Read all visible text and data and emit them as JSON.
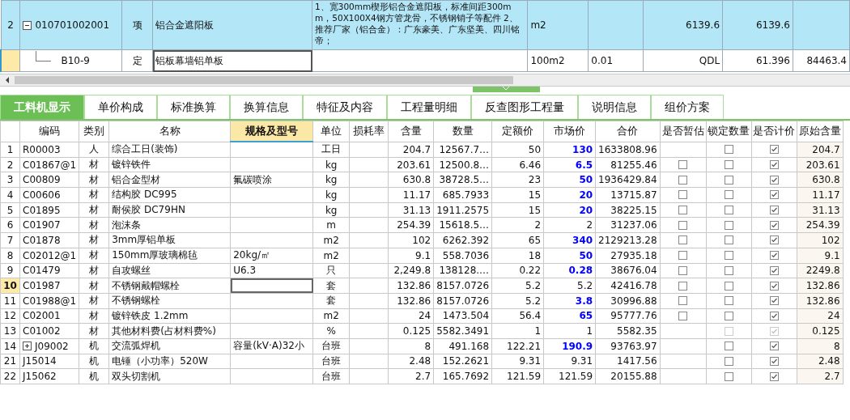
{
  "upper_grid": {
    "rows": [
      {
        "number": "2",
        "selected": false,
        "code": "010701002001",
        "expanded": true,
        "editing": false,
        "cells": [
          "项",
          "铝合金遮阳板",
          "1、宽300mm楔形铝合金遮阳板，标准间距300mm，50X100X4钢方管龙骨，不锈钢销子等配件 2、推荐厂家（铝合金）：广东豪美、广东坚美、四川铭帝；",
          "m2",
          null,
          "6139.6",
          "6139.6",
          null
        ]
      },
      {
        "selected": true,
        "code": "B10-9",
        "editing": true,
        "cells": [
          "定",
          "铝板幕墙铝单板",
          null,
          "100m2",
          "0.01",
          "QDL",
          "61.396",
          "84463.4"
        ]
      }
    ]
  },
  "tabs": [
    {
      "label": "工料机显示",
      "selected": true
    },
    {
      "label": "单价构成",
      "selected": false
    },
    {
      "label": "标准换算",
      "selected": false
    },
    {
      "label": "换算信息",
      "selected": false
    },
    {
      "label": "特征及内容",
      "selected": false
    },
    {
      "label": "工程量明细",
      "selected": false
    },
    {
      "label": "反查图形工程量",
      "selected": false
    },
    {
      "label": "说明信息",
      "selected": false
    },
    {
      "label": "组价方案",
      "selected": false
    }
  ],
  "table": {
    "columns": [
      {
        "label": "编码",
        "selected": false
      },
      {
        "label": "类别",
        "selected": false
      },
      {
        "label": "名称",
        "selected": false
      },
      {
        "label": "规格及型号",
        "selected": true
      },
      {
        "label": "单位",
        "selected": false
      },
      {
        "label": "损耗率",
        "selected": false
      },
      {
        "label": "含量",
        "selected": false
      },
      {
        "label": "数量",
        "selected": false
      },
      {
        "label": "定额价",
        "selected": false
      },
      {
        "label": "市场价",
        "selected": false
      },
      {
        "label": "合价",
        "selected": false
      },
      {
        "label": "是否暂估",
        "selected": false
      },
      {
        "label": "锁定数量",
        "selected": false
      },
      {
        "label": "是否计价",
        "selected": false
      },
      {
        "label": "原始含量",
        "selected": false
      }
    ],
    "rows": [
      {
        "number": "1",
        "selected": false,
        "code": "R00003",
        "type": "人",
        "name": "综合工日(装饰)",
        "unit": "工日",
        "amount": "204.7",
        "quantity": "12567.7…",
        "quota_price": "50",
        "market_price": "130",
        "modified": true,
        "total": "1633808.96",
        "locked": false,
        "priced": true,
        "disabled": false,
        "original": "204.7"
      },
      {
        "number": "2",
        "selected": false,
        "code": "C01867@1",
        "type": "材",
        "name": "镀锌铁件",
        "unit": "kg",
        "amount": "203.61",
        "quantity": "12500.8…",
        "quota_price": "6.46",
        "market_price": "6.5",
        "modified": true,
        "total": "81255.46",
        "provisional": false,
        "locked": false,
        "priced": true,
        "disabled": false,
        "original": "203.61"
      },
      {
        "number": "3",
        "selected": false,
        "code": "C00809",
        "type": "材",
        "name": "铝合金型材",
        "spec": "氟碳喷涂",
        "unit": "kg",
        "amount": "630.8",
        "quantity": "38728.5…",
        "quota_price": "23",
        "market_price": "50",
        "modified": true,
        "total": "1936429.84",
        "provisional": false,
        "locked": false,
        "priced": true,
        "disabled": false,
        "original": "630.8"
      },
      {
        "number": "4",
        "selected": false,
        "code": "C00606",
        "type": "材",
        "name": "结构胶 DC995",
        "unit": "kg",
        "amount": "11.17",
        "quantity": "685.7933",
        "quota_price": "15",
        "market_price": "20",
        "modified": true,
        "total": "13715.87",
        "provisional": false,
        "locked": false,
        "priced": true,
        "disabled": false,
        "original": "11.17"
      },
      {
        "number": "5",
        "selected": false,
        "code": "C01895",
        "type": "材",
        "name": "耐侯胶 DC79HN",
        "unit": "kg",
        "amount": "31.13",
        "quantity": "1911.2575",
        "quota_price": "15",
        "market_price": "20",
        "modified": true,
        "total": "38225.15",
        "provisional": false,
        "locked": false,
        "priced": true,
        "disabled": false,
        "original": "31.13"
      },
      {
        "number": "6",
        "selected": false,
        "code": "C01907",
        "type": "材",
        "name": "泡沫条",
        "unit": "m",
        "amount": "254.39",
        "quantity": "15618.5…",
        "quota_price": "2",
        "market_price": "2",
        "modified": false,
        "total": "31237.06",
        "provisional": false,
        "locked": false,
        "priced": true,
        "disabled": false,
        "original": "254.39"
      },
      {
        "number": "7",
        "selected": false,
        "code": "C01878",
        "type": "材",
        "name": "3mm厚铝单板",
        "unit": "m2",
        "amount": "102",
        "quantity": "6262.392",
        "quota_price": "65",
        "market_price": "340",
        "modified": true,
        "total": "2129213.28",
        "provisional": false,
        "locked": false,
        "priced": true,
        "disabled": false,
        "original": "102"
      },
      {
        "number": "8",
        "selected": false,
        "code": "C02012@1",
        "type": "材",
        "name": "150mm厚玻璃棉毡",
        "spec": "20kg/㎡",
        "unit": "m2",
        "amount": "9.1",
        "quantity": "558.7036",
        "quota_price": "18",
        "market_price": "50",
        "modified": true,
        "total": "27935.18",
        "provisional": false,
        "locked": false,
        "priced": true,
        "disabled": false,
        "original": "9.1"
      },
      {
        "number": "9",
        "selected": false,
        "code": "C01479",
        "type": "材",
        "name": "自攻螺丝",
        "spec": "U6.3",
        "unit": "只",
        "amount": "2,249.8",
        "quantity": "138128.…",
        "quota_price": "0.22",
        "market_price": "0.28",
        "modified": true,
        "total": "38676.04",
        "provisional": false,
        "locked": false,
        "priced": true,
        "disabled": false,
        "original": "2249.8"
      },
      {
        "number": "10",
        "selected": true,
        "code": "C01987",
        "type": "材",
        "name": "不锈钢戴帽螺栓",
        "unit": "套",
        "amount": "132.86",
        "quantity": "8157.0726",
        "quota_price": "5.2",
        "market_price": "5.2",
        "modified": false,
        "total": "42416.78",
        "provisional": false,
        "locked": false,
        "priced": true,
        "disabled": false,
        "original": "132.86"
      },
      {
        "number": "11",
        "selected": false,
        "code": "C01988@1",
        "type": "材",
        "name": "不锈钢螺栓",
        "unit": "套",
        "amount": "132.86",
        "quantity": "8157.0726",
        "quota_price": "5.2",
        "market_price": "3.8",
        "modified": true,
        "total": "30996.88",
        "provisional": false,
        "locked": false,
        "priced": true,
        "disabled": false,
        "original": "132.86"
      },
      {
        "number": "12",
        "selected": false,
        "code": "C02001",
        "type": "材",
        "name": "镀锌铁皮 1.2mm",
        "unit": "m2",
        "amount": "24",
        "quantity": "1473.504",
        "quota_price": "56.4",
        "market_price": "65",
        "modified": true,
        "total": "95777.76",
        "provisional": false,
        "locked": false,
        "priced": true,
        "disabled": false,
        "original": "24"
      },
      {
        "number": "13",
        "selected": false,
        "code": "C01002",
        "type": "材",
        "name": "其他材料费(占材料费%)",
        "unit": "%",
        "amount": "0.125",
        "quantity": "5582.3491",
        "quota_price": "1",
        "market_price": "1",
        "modified": false,
        "total": "5582.35",
        "locked": false,
        "priced": true,
        "disabled": true,
        "original": "0.125"
      },
      {
        "number": "14",
        "selected": false,
        "expanded": false,
        "code": "J09002",
        "type": "机",
        "name": "交流弧焊机",
        "spec": "容量(kV·A)32小",
        "unit": "台班",
        "amount": "8",
        "quantity": "491.168",
        "quota_price": "122.21",
        "market_price": "190.9",
        "modified": true,
        "total": "93763.97",
        "locked": false,
        "priced": true,
        "disabled": false,
        "original": "8"
      },
      {
        "number": "21",
        "selected": false,
        "code": "J15014",
        "type": "机",
        "name": "电锤（小功率）520W",
        "unit": "台班",
        "amount": "2.48",
        "quantity": "152.2621",
        "quota_price": "9.31",
        "market_price": "9.31",
        "modified": false,
        "total": "1417.56",
        "locked": false,
        "priced": true,
        "disabled": false,
        "original": "2.48"
      },
      {
        "number": "22",
        "selected": false,
        "code": "J15062",
        "type": "机",
        "name": "双头切割机",
        "unit": "台班",
        "amount": "2.7",
        "quantity": "165.7692",
        "quota_price": "121.59",
        "market_price": "121.59",
        "modified": false,
        "total": "20155.88",
        "locked": false,
        "priced": true,
        "disabled": false,
        "original": "2.7"
      }
    ]
  }
}
